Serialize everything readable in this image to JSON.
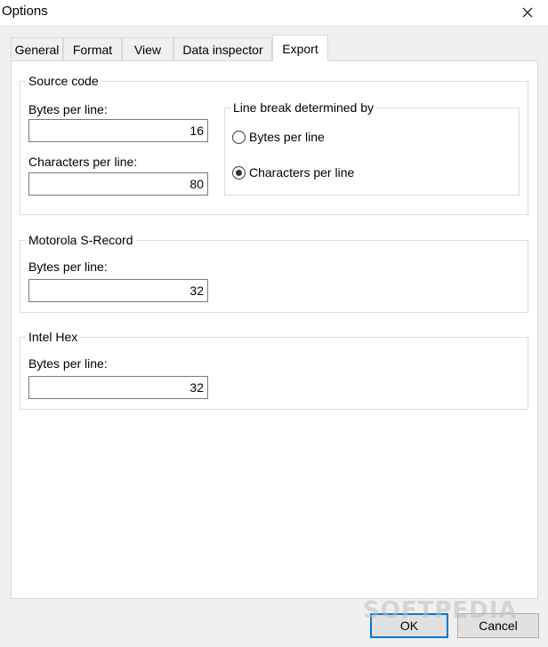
{
  "window": {
    "title": "Options",
    "close_icon": "close-icon"
  },
  "tabs": [
    {
      "label": "General",
      "active": false
    },
    {
      "label": "Format",
      "active": false
    },
    {
      "label": "View",
      "active": false
    },
    {
      "label": "Data inspector",
      "active": false
    },
    {
      "label": "Export",
      "active": true
    }
  ],
  "source_code": {
    "legend": "Source code",
    "bytes_label": "Bytes per line:",
    "bytes_value": "16",
    "chars_label": "Characters per line:",
    "chars_value": "80",
    "line_break": {
      "legend": "Line break determined by",
      "options": [
        {
          "label": "Bytes per line",
          "checked": false
        },
        {
          "label": "Characters per line",
          "checked": true
        }
      ]
    }
  },
  "motorola": {
    "legend": "Motorola S-Record",
    "bytes_label": "Bytes per line:",
    "bytes_value": "32"
  },
  "intel": {
    "legend": "Intel Hex",
    "bytes_label": "Bytes per line:",
    "bytes_value": "32"
  },
  "buttons": {
    "ok": "OK",
    "cancel": "Cancel"
  },
  "watermark": "SOFTPEDIA",
  "colors": {
    "window_bg": "#f0f0f0",
    "panel_bg": "#ffffff",
    "default_button_border": "#0078d7"
  }
}
